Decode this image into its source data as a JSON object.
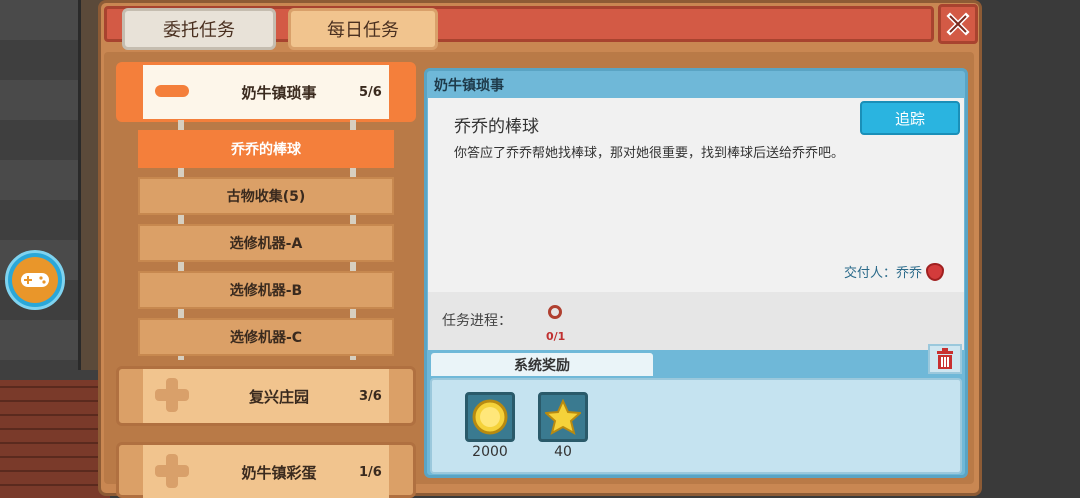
{
  "tabs": {
    "commission": "委托任务",
    "daily": "每日任务"
  },
  "categories": [
    {
      "title": "奶牛镇琐事",
      "count": "5/6"
    },
    {
      "title": "复兴庄园",
      "count": "3/6"
    },
    {
      "title": "奶牛镇彩蛋",
      "count": "1/6"
    }
  ],
  "subtasks": [
    "乔乔的棒球",
    "古物收集(5)",
    "选修机器-A",
    "选修机器-B",
    "选修机器-C"
  ],
  "detail": {
    "header": "奶牛镇琐事",
    "title": "乔乔的棒球",
    "description": "你答应了乔乔帮她找棒球，那对她很重要，找到棒球后送给乔乔吧。",
    "track_label": "追踪",
    "giver_label": "交付人：乔乔",
    "progress_label": "任务进程：",
    "progress_value": "0/1",
    "rewards_tab": "系统奖励",
    "rewards": [
      {
        "icon": "coin-icon",
        "value": "2000"
      },
      {
        "icon": "star-icon",
        "value": "40"
      }
    ]
  },
  "colors": {
    "accent_orange": "#f47f3b",
    "panel_brown": "#c98752",
    "header_red": "#d35a45",
    "detail_blue": "#6fb8d8",
    "track_blue": "#2ab4e0"
  }
}
